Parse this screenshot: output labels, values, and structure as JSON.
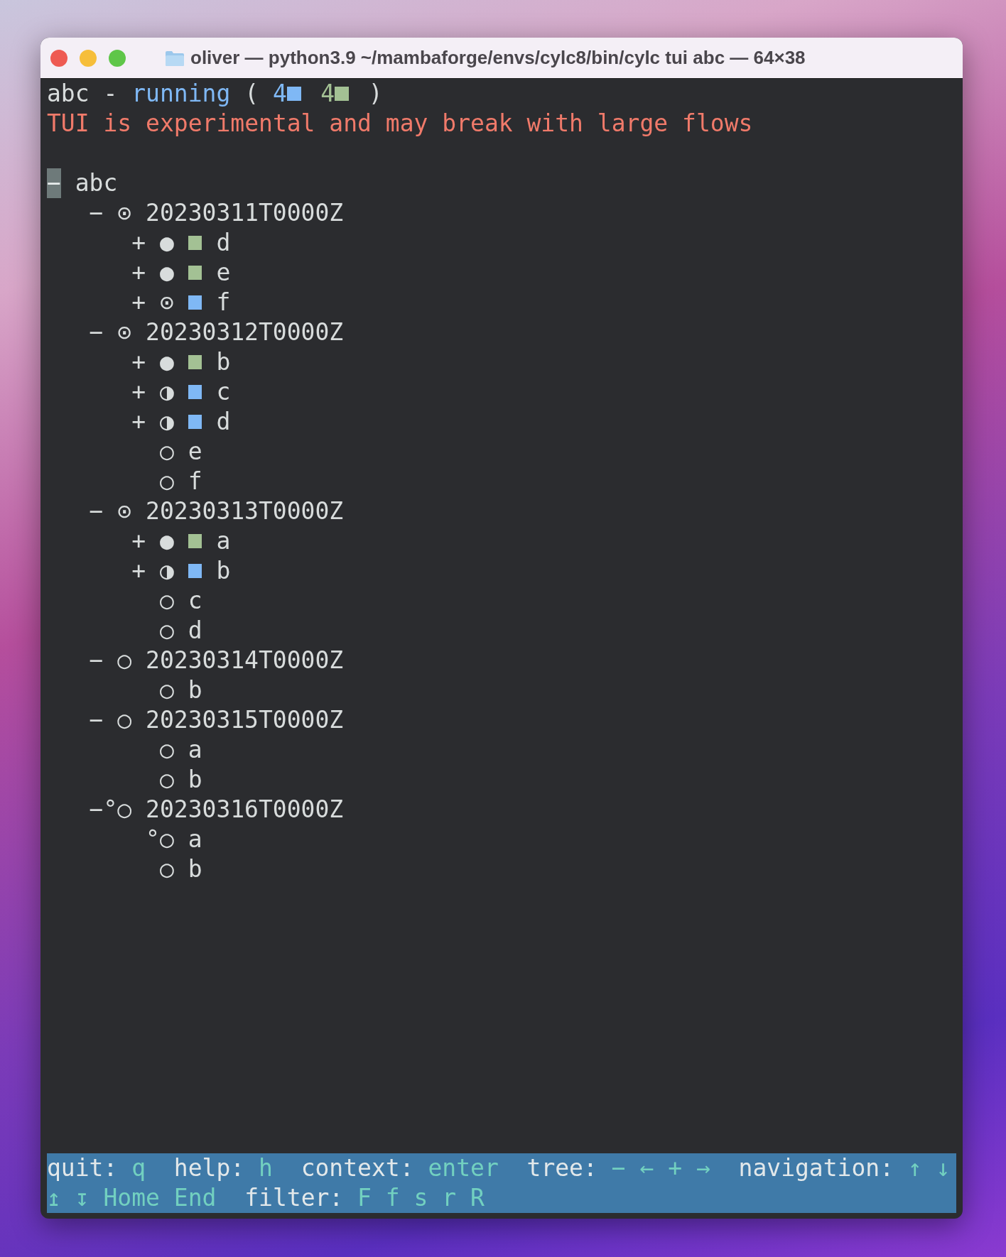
{
  "window": {
    "title": "oliver — python3.9 ~/mambaforge/envs/cylc8/bin/cylc tui abc — 64×38"
  },
  "header": {
    "workflow": "abc",
    "separator": "-",
    "status": "running",
    "open_paren": "(",
    "counts": [
      {
        "count": "4",
        "color": "#7fb8f5"
      },
      {
        "count": "4",
        "color": "#a3c194"
      }
    ],
    "close_paren": ")"
  },
  "warning": "TUI is experimental and may break with large flows",
  "tree": {
    "toggle": "−",
    "name": "abc",
    "selected": true,
    "children": [
      {
        "toggle": "−",
        "icon": "⊙",
        "name": "20230311T0000Z",
        "selected": false,
        "children": [
          {
            "toggle": "+",
            "icon": "●",
            "color": "#a3c194",
            "name": "d",
            "selected": false
          },
          {
            "toggle": "+",
            "icon": "●",
            "color": "#a3c194",
            "name": "e",
            "selected": false
          },
          {
            "toggle": "+",
            "icon": "⊙",
            "color": "#7fb8f5",
            "name": "f",
            "selected": false
          }
        ]
      },
      {
        "toggle": "−",
        "icon": "⊙",
        "name": "20230312T0000Z",
        "selected": false,
        "children": [
          {
            "toggle": "+",
            "icon": "●",
            "color": "#a3c194",
            "name": "b",
            "selected": false
          },
          {
            "toggle": "+",
            "icon": "◑",
            "color": "#7fb8f5",
            "name": "c",
            "selected": false
          },
          {
            "toggle": "+",
            "icon": "◑",
            "color": "#7fb8f5",
            "name": "d",
            "selected": false
          },
          {
            "icon": "○",
            "name": "e",
            "selected": false
          },
          {
            "icon": "○",
            "name": "f",
            "selected": false
          }
        ]
      },
      {
        "toggle": "−",
        "icon": "⊙",
        "name": "20230313T0000Z",
        "selected": false,
        "children": [
          {
            "toggle": "+",
            "icon": "●",
            "color": "#a3c194",
            "name": "a",
            "selected": false
          },
          {
            "toggle": "+",
            "icon": "◑",
            "color": "#7fb8f5",
            "name": "b",
            "selected": false
          },
          {
            "icon": "○",
            "name": "c",
            "selected": false
          },
          {
            "icon": "○",
            "name": "d",
            "selected": false
          }
        ]
      },
      {
        "toggle": "−",
        "icon": "○",
        "name": "20230314T0000Z",
        "selected": false,
        "children": [
          {
            "icon": "○",
            "name": "b",
            "selected": false
          }
        ]
      },
      {
        "toggle": "−",
        "icon": "○",
        "name": "20230315T0000Z",
        "selected": false,
        "children": [
          {
            "icon": "○",
            "name": "a",
            "selected": false
          },
          {
            "icon": "○",
            "name": "b",
            "selected": false
          }
        ]
      },
      {
        "toggle": "−",
        "marker": "°",
        "icon": "○",
        "name": "20230316T0000Z",
        "selected": false,
        "children": [
          {
            "marker": "°",
            "icon": "○",
            "name": "a",
            "selected": false
          },
          {
            "icon": "○",
            "name": "b",
            "selected": false
          }
        ]
      }
    ]
  },
  "footer": {
    "lines": [
      [
        {
          "label": "quit:",
          "keys": "q"
        },
        {
          "label": "help:",
          "keys": "h"
        },
        {
          "label": "context:",
          "keys": "enter"
        },
        {
          "label": "tree:",
          "keys": "− ← + →"
        },
        {
          "label": "navigation:",
          "keys": "↑ ↓"
        }
      ],
      [
        {
          "keys": "↥ ↧ Home End"
        },
        {
          "label": "filter:",
          "keys": "F f s r R"
        }
      ]
    ]
  }
}
